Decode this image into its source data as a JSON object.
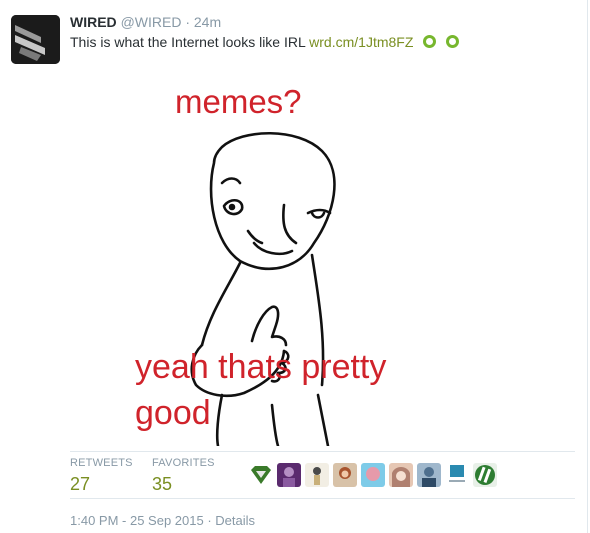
{
  "tweet": {
    "author_name": "WIRED",
    "author_handle": "@WIRED",
    "separator": "·",
    "time_ago": "24m",
    "text": "This is what the Internet looks like IRL",
    "link_text": "wrd.cm/1Jtm8FZ",
    "vine_icon_color": "#77b72e",
    "link_color": "#7a8f22"
  },
  "media": {
    "caption_top": "memes?",
    "caption_bottom_line1": "yeah thats pretty",
    "caption_bottom_line2": "good",
    "text_color": "#d0232b"
  },
  "stats": {
    "retweets_label": "RETWEETS",
    "retweets_count": "27",
    "favorites_label": "FAVORITES",
    "favorites_count": "35"
  },
  "favoriters": [
    {
      "icon": "superman-logo-icon",
      "color": "#3a7a2a"
    },
    {
      "icon": "avatar-purple",
      "color": "#5a2a6e"
    },
    {
      "icon": "avatar-figure",
      "color": "#c9b07a"
    },
    {
      "icon": "avatar-woman",
      "color": "#a8542e"
    },
    {
      "icon": "avatar-pink",
      "color": "#e69aaa"
    },
    {
      "icon": "avatar-anime",
      "color": "#e6c7b4"
    },
    {
      "icon": "avatar-man",
      "color": "#4e6f8e"
    },
    {
      "icon": "active-logo-icon",
      "color": "#2a8ab0"
    },
    {
      "icon": "stripes-logo-icon",
      "color": "#2e7d32"
    }
  ],
  "footer": {
    "timestamp": "1:40 PM - 25 Sep 2015",
    "separator": "·",
    "details_label": "Details"
  }
}
